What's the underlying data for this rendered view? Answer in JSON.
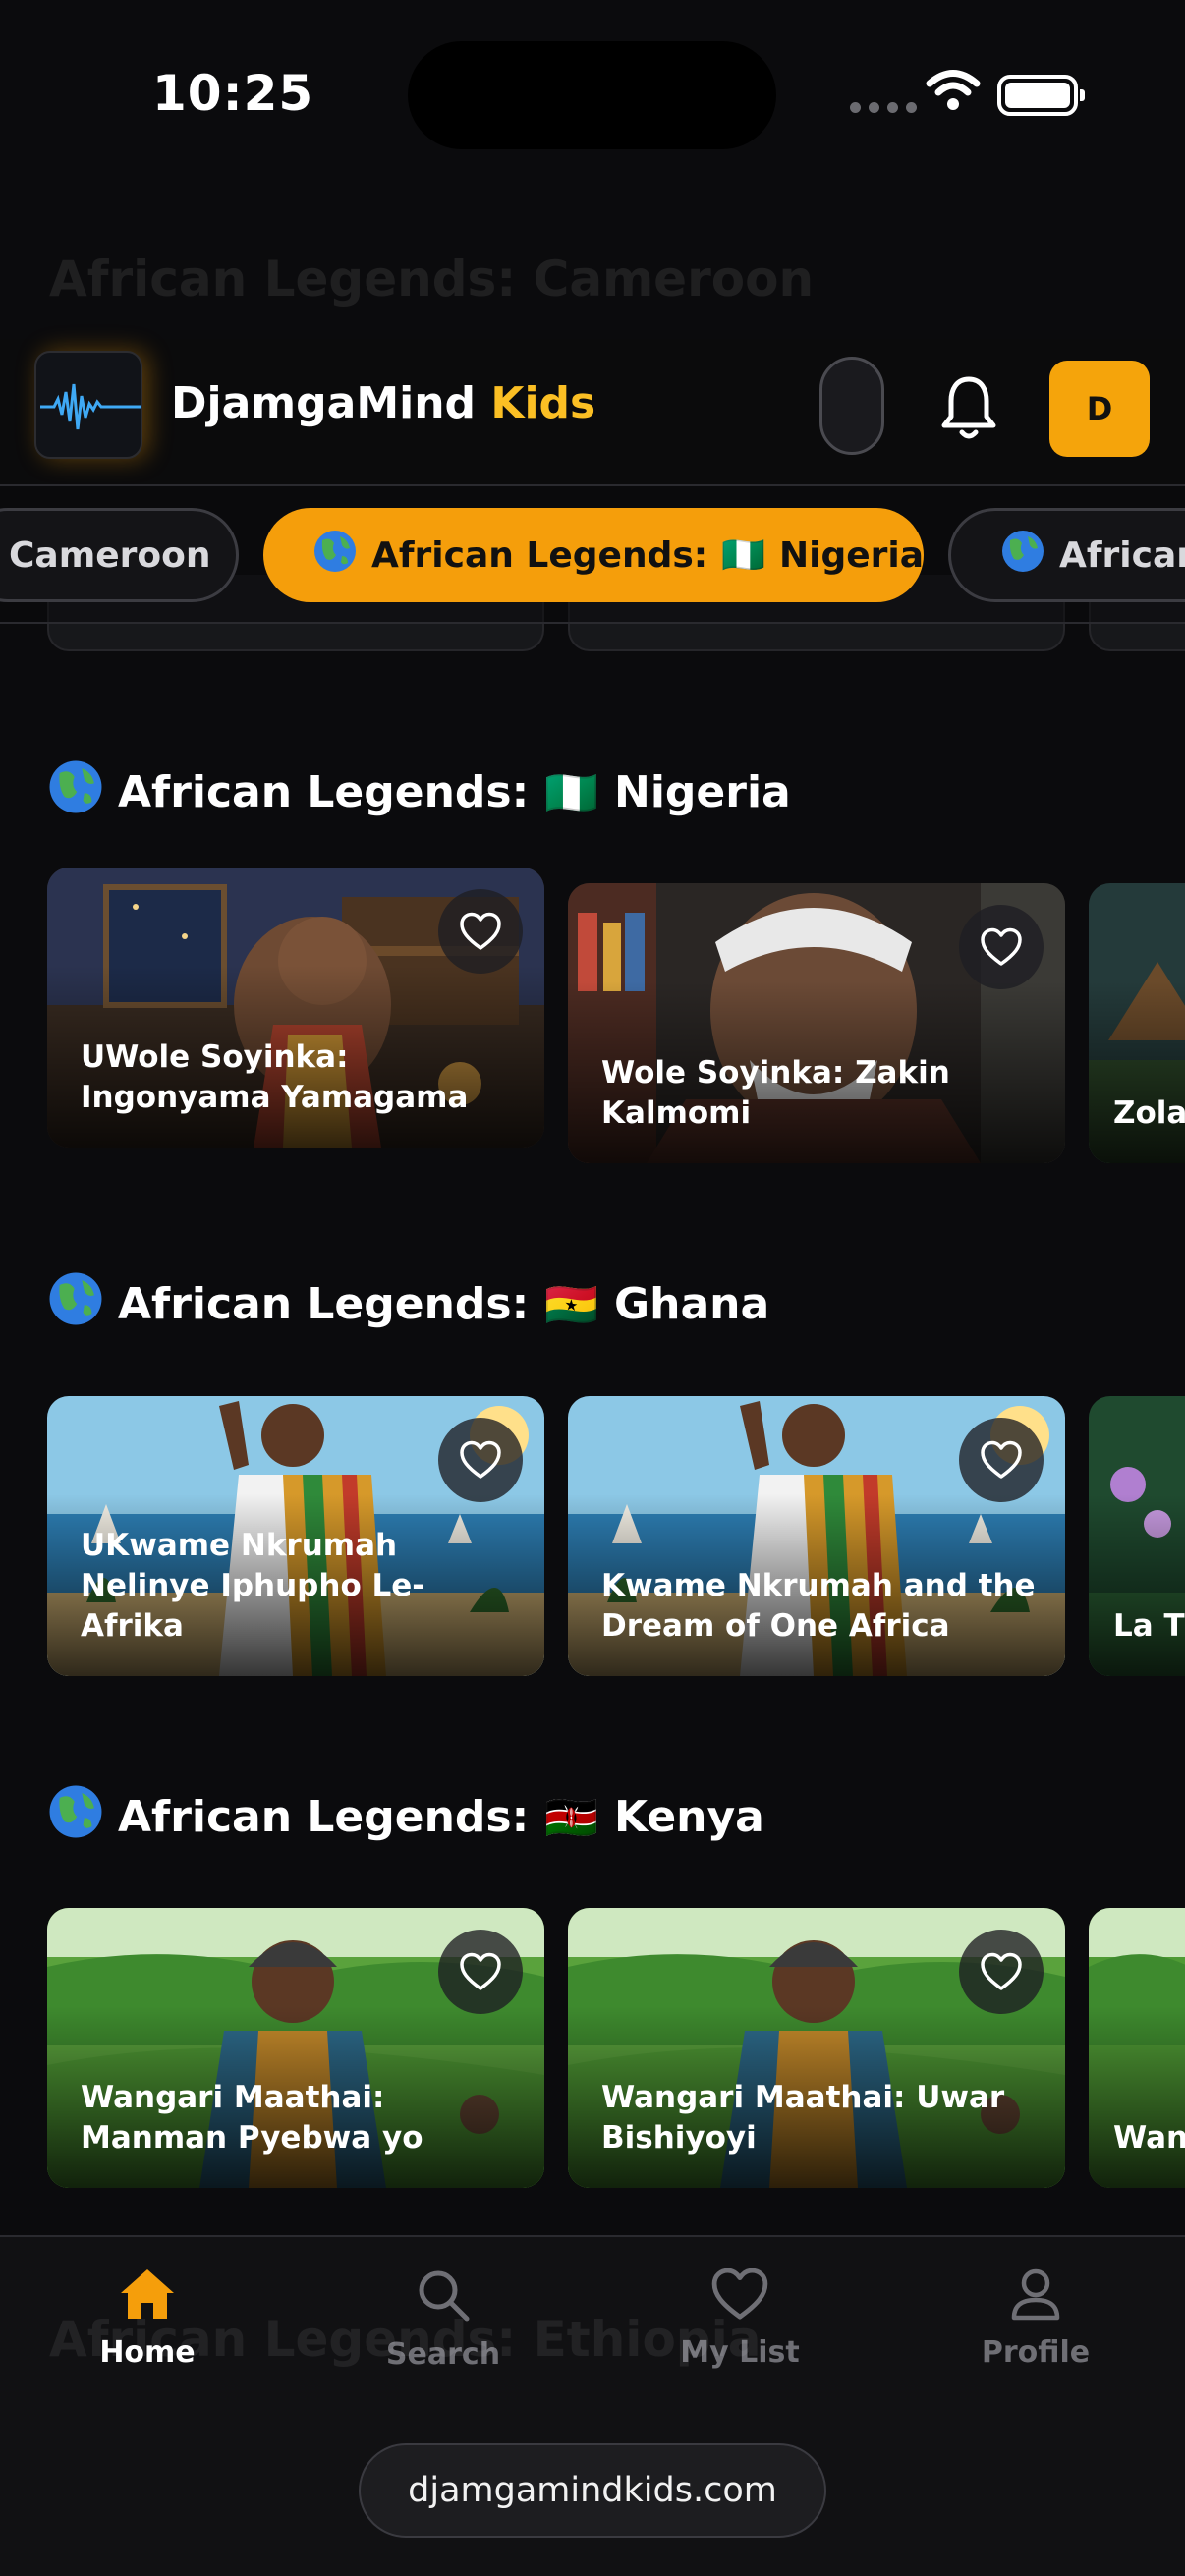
{
  "status_bar": {
    "time": "10:25"
  },
  "ghost": {
    "header_text": "African Legends: Cameroon",
    "footer_text": "African Legends: Ethiopia"
  },
  "header": {
    "title_part1": "DjamgaMind",
    "title_part2": " Kids",
    "avatar_initial": "D",
    "accent_color": "#f59e0b"
  },
  "chips": [
    {
      "label": "Cameroon",
      "flag": "",
      "active": false
    },
    {
      "label": "African Legends:",
      "flag": "🇳🇬",
      "country": "Nigeria",
      "active": true
    },
    {
      "label": "African",
      "active": false
    }
  ],
  "sections": [
    {
      "title_prefix": "African Legends:",
      "flag": "🇳🇬",
      "country": "Nigeria",
      "cards": [
        {
          "title": "UWole Soyinka: Ingonyama Yamagama"
        },
        {
          "title": "Wole Soyinka: Zakin Kalmomi"
        },
        {
          "title": "Zola Blan"
        }
      ]
    },
    {
      "title_prefix": "African Legends:",
      "flag": "🇬🇭",
      "country": "Ghana",
      "cards": [
        {
          "title": "UKwame Nkrumah Nelinye Iphupho Le-Afrika"
        },
        {
          "title": "Kwame Nkrumah and the Dream of One Africa"
        },
        {
          "title": "La T"
        }
      ]
    },
    {
      "title_prefix": "African Legends:",
      "flag": "🇰🇪",
      "country": "Kenya",
      "cards": [
        {
          "title": "Wangari Maathai: Manman Pyebwa yo"
        },
        {
          "title": "Wangari Maathai: Uwar Bishiyoyi"
        },
        {
          "title": "Wan a Ch"
        }
      ]
    }
  ],
  "bottom_nav": [
    {
      "label": "Home",
      "icon": "home-icon",
      "active": true
    },
    {
      "label": "Search",
      "icon": "search-icon",
      "active": false
    },
    {
      "label": "My List",
      "icon": "heart-icon",
      "active": false
    },
    {
      "label": "Profile",
      "icon": "profile-icon",
      "active": false
    }
  ],
  "footer": {
    "url": "djamgamindkids.com"
  }
}
